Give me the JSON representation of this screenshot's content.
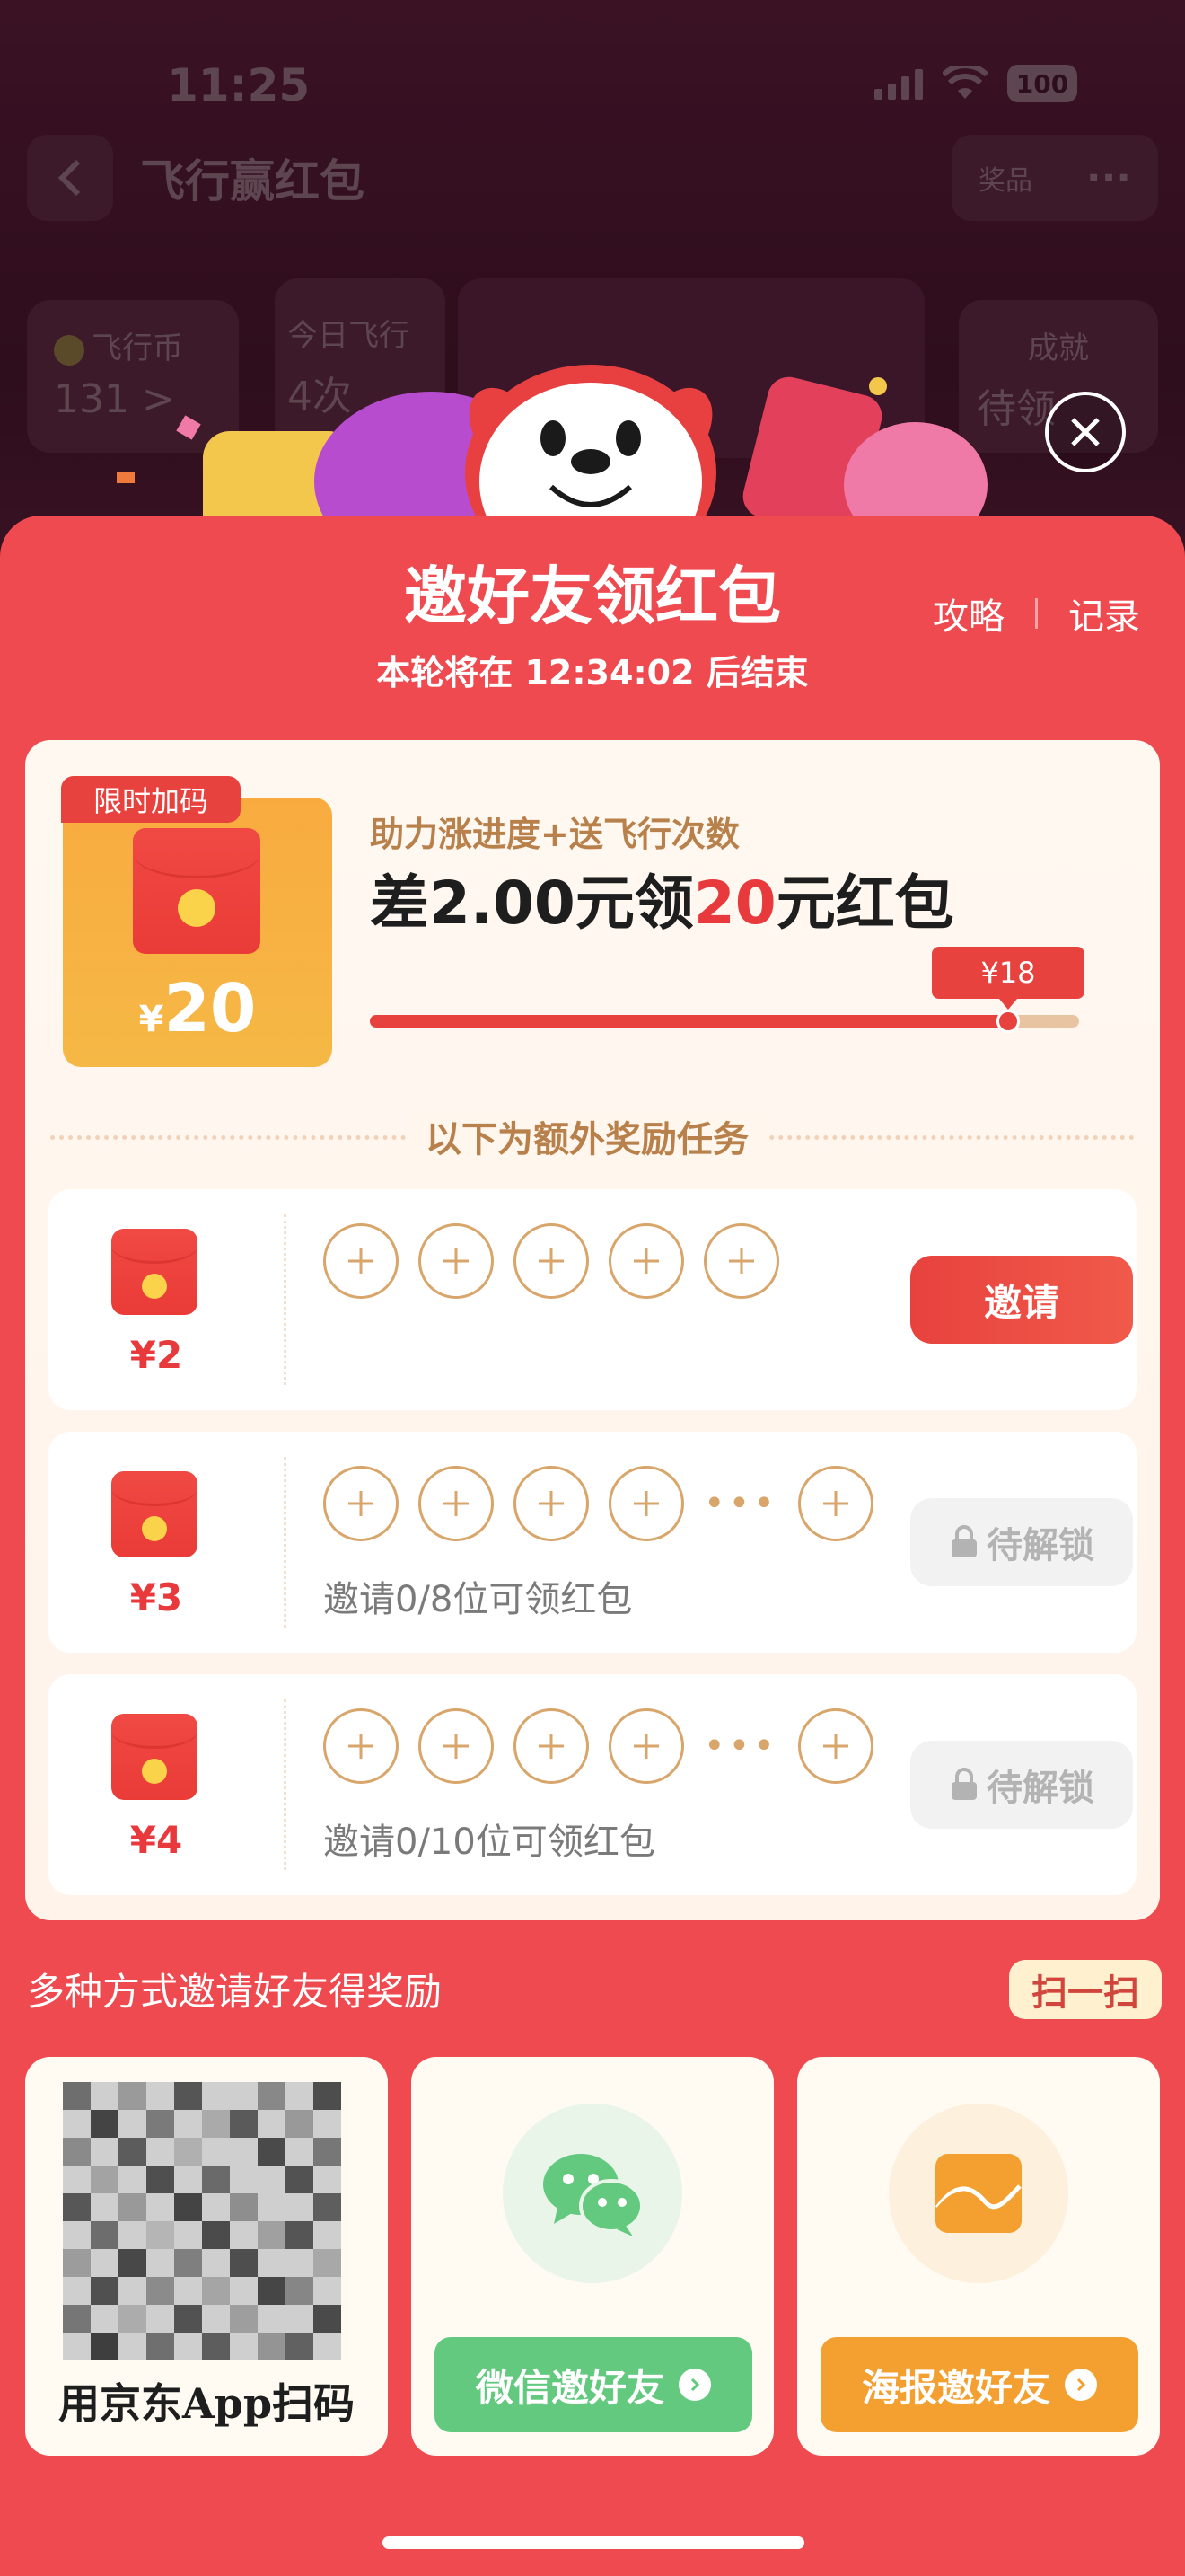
{
  "status_bar": {
    "time": "11:25",
    "battery": "100"
  },
  "nav": {
    "title": "飞行赢红包",
    "prize_label": "奖品",
    "more_label": "···"
  },
  "background_cards": {
    "coins_label": "飞行币",
    "coins_value": "131 >",
    "today_label": "今日飞行",
    "today_value": "4次",
    "achievement_label": "成就",
    "achievement_value": "待领"
  },
  "modal": {
    "title": "邀好友领红包",
    "countdown": "本轮将在 12:34:02 后结束",
    "strategy_link": "攻略",
    "records_link": "记录"
  },
  "progress_card": {
    "badge": "限时加码",
    "packet_currency": "¥",
    "packet_amount": "20",
    "help_text": "助力涨进度+送飞行次数",
    "diff_prefix": "差2.00元领",
    "diff_highlight": "20",
    "diff_suffix": "元红包",
    "tip_label": "¥18",
    "progress": 0.9
  },
  "extra_tasks_label": "以下为额外奖励任务",
  "tasks": [
    {
      "amount": "¥2",
      "hint": "",
      "button": "邀请",
      "locked": false
    },
    {
      "amount": "¥3",
      "hint": "邀请0/8位可领红包",
      "button": "待解锁",
      "locked": true
    },
    {
      "amount": "¥4",
      "hint": "邀请0/10位可领红包",
      "button": "待解锁",
      "locked": true
    }
  ],
  "share": {
    "label": "多种方式邀请好友得奖励",
    "scan_button": "扫一扫",
    "qr_caption": "用京东App扫码",
    "wechat_button": "微信邀好友",
    "poster_button": "海报邀好友"
  },
  "colors": {
    "brand_red": "#ee4a4f",
    "accent_red": "#e8423e",
    "wechat_green": "#62c97f",
    "poster_orange": "#f4a030"
  }
}
